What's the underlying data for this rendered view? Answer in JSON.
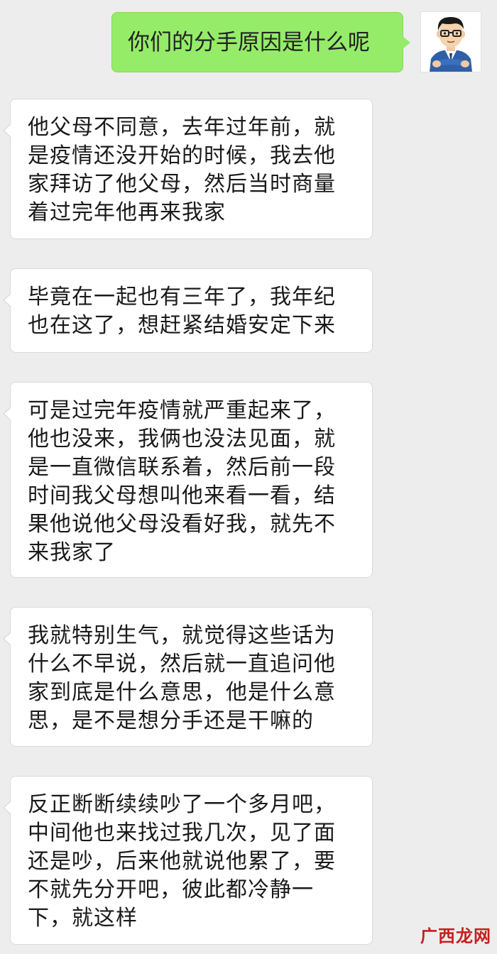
{
  "sent_message": {
    "text": "你们的分手原因是什么呢",
    "bubble_color": "#95ec69"
  },
  "avatar": {
    "description_icon": "cartoon-man-avatar-icon"
  },
  "received_messages": [
    {
      "lines": [
        "他父母不同意，去年过年前，就",
        "是疫情还没开始的时候，我去他",
        "家拜访了他父母，然后当时商量",
        "着过完年他再来我家"
      ]
    },
    {
      "lines": [
        "毕竟在一起也有三年了，我年纪",
        "也在这了，想赶紧结婚安定下来"
      ]
    },
    {
      "lines": [
        "可是过完年疫情就严重起来了，",
        "他也没来，我俩也没法见面，就",
        "是一直微信联系着，然后前一段",
        "时间我父母想叫他来看一看，结",
        "果他说他父母没看好我，就先不",
        "来我家了"
      ]
    },
    {
      "lines": [
        "我就特别生气，就觉得这些话为",
        "什么不早说，然后就一直追问他",
        "家到底是什么意思，他是什么意",
        "思，是不是想分手还是干嘛的"
      ]
    },
    {
      "lines": [
        "反正断断续续吵了一个多月吧，",
        "中间他也来找过我几次，见了面",
        "还是吵，后来他就说他累了，要",
        "不就先分开吧，彼此都冷静一",
        "下，就这样"
      ]
    }
  ],
  "watermark": {
    "text": "广西龙网",
    "color": "#c41f1f"
  },
  "colors": {
    "background": "#ededed",
    "received_bubble": "#ffffff"
  }
}
